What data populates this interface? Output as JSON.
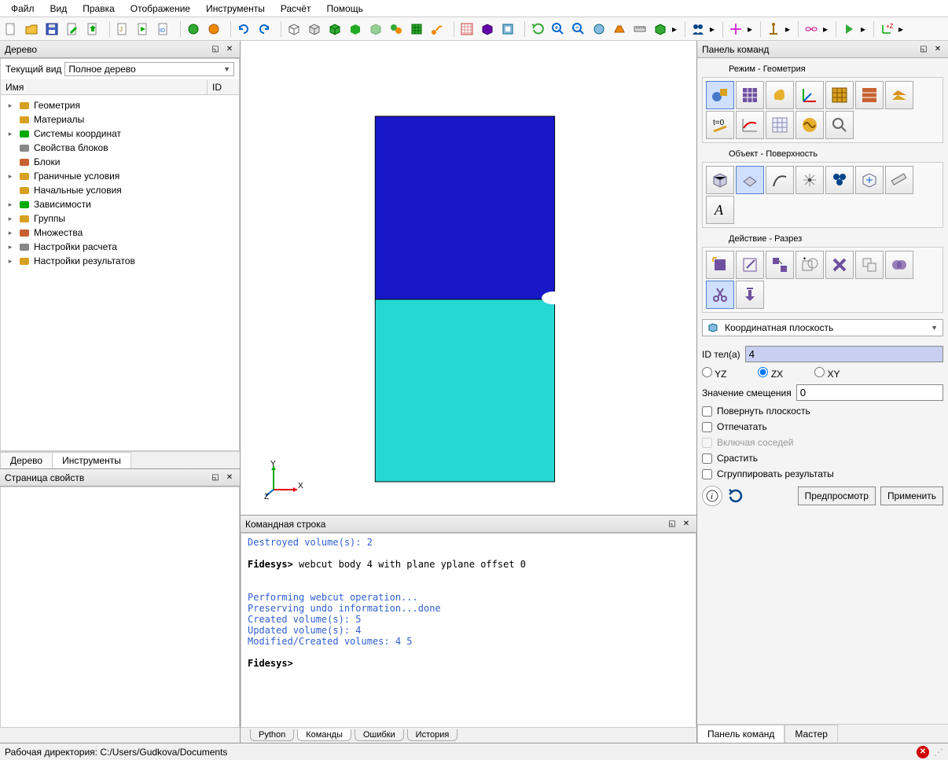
{
  "menu": [
    "Файл",
    "Вид",
    "Правка",
    "Отображение",
    "Инструменты",
    "Расчёт",
    "Помощь"
  ],
  "panes": {
    "tree_title": "Дерево",
    "props_title": "Страница свойств",
    "cmd_title": "Командная строка",
    "cp_title": "Панель команд"
  },
  "tree": {
    "view_label": "Текущий вид",
    "view_value": "Полное дерево",
    "col_name": "Имя",
    "col_id": "ID",
    "items": [
      {
        "label": "Геометрия",
        "exp": true,
        "icon": "cube"
      },
      {
        "label": "Материалы",
        "exp": false,
        "icon": "material"
      },
      {
        "label": "Системы координат",
        "exp": true,
        "icon": "axes"
      },
      {
        "label": "Свойства блоков",
        "exp": false,
        "icon": "wrench"
      },
      {
        "label": "Блоки",
        "exp": false,
        "icon": "block"
      },
      {
        "label": "Граничные условия",
        "exp": true,
        "icon": "bc"
      },
      {
        "label": "Начальные условия",
        "exp": false,
        "icon": "ic"
      },
      {
        "label": "Зависимости",
        "exp": true,
        "icon": "dep"
      },
      {
        "label": "Группы",
        "exp": true,
        "icon": "group"
      },
      {
        "label": "Множества",
        "exp": true,
        "icon": "set"
      },
      {
        "label": "Настройки расчета",
        "exp": true,
        "icon": "calc"
      },
      {
        "label": "Настройки результатов",
        "exp": true,
        "icon": "result"
      }
    ],
    "tabs": [
      "Дерево",
      "Инструменты"
    ]
  },
  "cmd": {
    "lines": [
      {
        "t": "Destroyed volume(s): 2",
        "cls": "cmd-blue"
      },
      {
        "t": "",
        "cls": ""
      },
      {
        "prefix": "Fidesys>",
        "body": " webcut body 4 with plane yplane offset 0"
      },
      {
        "t": "",
        "cls": ""
      },
      {
        "t": "",
        "cls": ""
      },
      {
        "t": "Performing webcut operation...",
        "cls": "cmd-blue"
      },
      {
        "t": "Preserving undo information...done",
        "cls": "cmd-blue"
      },
      {
        "t": "Created volume(s): 5",
        "cls": "cmd-blue"
      },
      {
        "t": "Updated volume(s): 4",
        "cls": "cmd-blue"
      },
      {
        "t": "Modified/Created volumes: 4 5",
        "cls": "cmd-blue"
      },
      {
        "t": "",
        "cls": ""
      },
      {
        "prefix": "Fidesys>",
        "body": ""
      }
    ],
    "tabs": [
      "Python",
      "Команды",
      "Ошибки",
      "История"
    ]
  },
  "cp": {
    "mode_title": "Режим - Геометрия",
    "object_title": "Объект - Поверхность",
    "action_title": "Действие - Разрез",
    "dropdown": "Координатная плоскость",
    "id_label": "ID тел(а)",
    "id_value": "4",
    "radios": [
      "YZ",
      "ZX",
      "XY"
    ],
    "radio_selected": "ZX",
    "offset_label": "Значение смещения",
    "offset_value": "0",
    "chk_rotate": "Повернуть плоскость",
    "chk_print": "Отпечатать",
    "chk_neighbors": "Включая соседей",
    "chk_merge": "Срастить",
    "chk_group": "Сгруппировать результаты",
    "preview": "Предпросмотр",
    "apply": "Применить",
    "right_tabs": [
      "Панель команд",
      "Мастер"
    ]
  },
  "status": {
    "workdir_label": "Рабочая директория:",
    "workdir_path": "C:/Users/Gudkova/Documents"
  },
  "axis": {
    "x": "X",
    "y": "Y",
    "z": "Z"
  }
}
